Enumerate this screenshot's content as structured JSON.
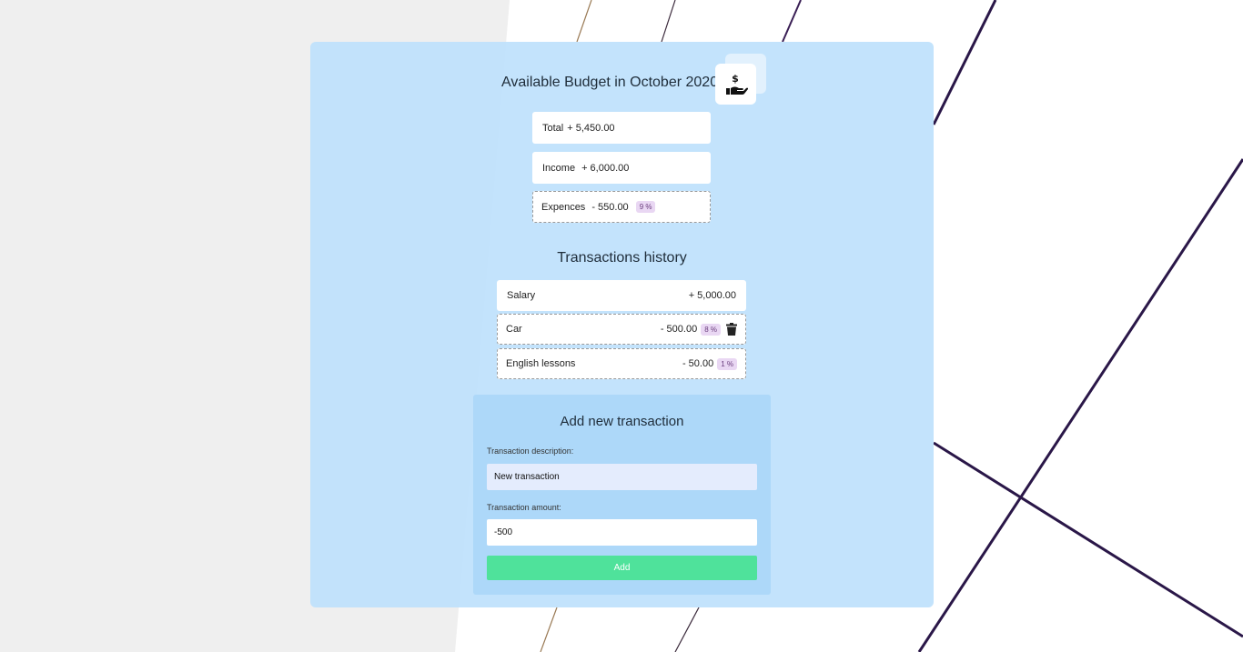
{
  "header": {
    "title": "Available Budget in October 2020",
    "logo_icon": "money-hand-icon"
  },
  "summary": {
    "total": {
      "label": "Total",
      "value": "+ 5,450.00"
    },
    "income": {
      "label": "Income",
      "value": "+ 6,000.00"
    },
    "expenses": {
      "label": "Expences",
      "value": "- 550.00",
      "percent": "9 %"
    }
  },
  "history": {
    "title": "Transactions history",
    "rows": [
      {
        "name": "Salary",
        "amount": "+ 5,000.00",
        "percent": ""
      },
      {
        "name": "Car",
        "amount": "- 500.00",
        "percent": "8 %",
        "delete_icon": "trash-icon"
      },
      {
        "name": "English lessons",
        "amount": "- 50.00",
        "percent": "1 %"
      }
    ]
  },
  "form": {
    "title": "Add new transaction",
    "description_label": "Transaction description:",
    "description_value": "New transaction",
    "amount_label": "Transaction amount:",
    "amount_value": "-500",
    "add_label": "Add"
  },
  "colors": {
    "panel": "#bee1fc",
    "form": "#add8f9",
    "add_button": "#4fe29b",
    "percent_badge": "#e9d7f3"
  }
}
